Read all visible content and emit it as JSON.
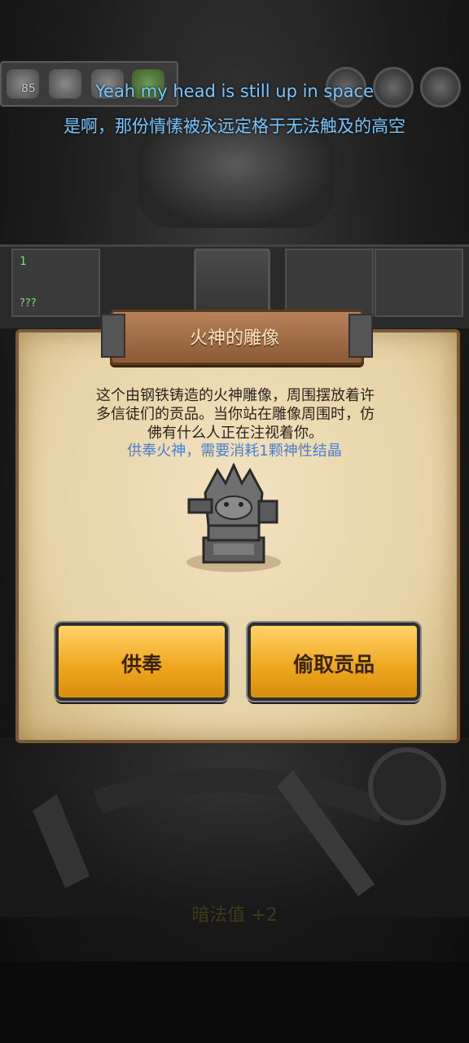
{
  "hud": {
    "resource_count": "85"
  },
  "subtitle": {
    "english": "Yeah my head is still up in space",
    "chinese": "是啊，那份情愫被永远定格于无法触及的高空"
  },
  "background": {
    "tile_level": "1",
    "tile_unknown": "???",
    "faded_text": "暗法值 +2"
  },
  "dialog": {
    "title": "火神的雕像",
    "description_lines": [
      "这个由钢铁铸造的火神雕像，周围摆放着许",
      "多信徒们的贡品。当你站在雕像周围时，仿",
      "佛有什么人正在注视着你。"
    ],
    "cost_text": "供奉火神，需要消耗1颗神性结晶",
    "buttons": {
      "worship": "供奉",
      "steal": "偷取贡品"
    }
  },
  "colors": {
    "subtitle": "#79c6ff",
    "cost": "#4a7fd2",
    "button": "#f0a91f"
  }
}
